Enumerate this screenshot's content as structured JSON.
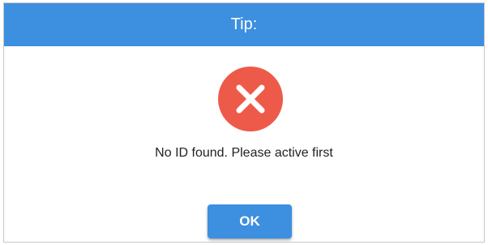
{
  "dialog": {
    "title": "Tip:",
    "icon": "error-x-icon",
    "message": "No ID found. Please active first",
    "ok_label": "OK"
  },
  "colors": {
    "title_bar": "#3d8fe0",
    "error_circle": "#ee5a4a",
    "button": "#3d8fe0"
  }
}
